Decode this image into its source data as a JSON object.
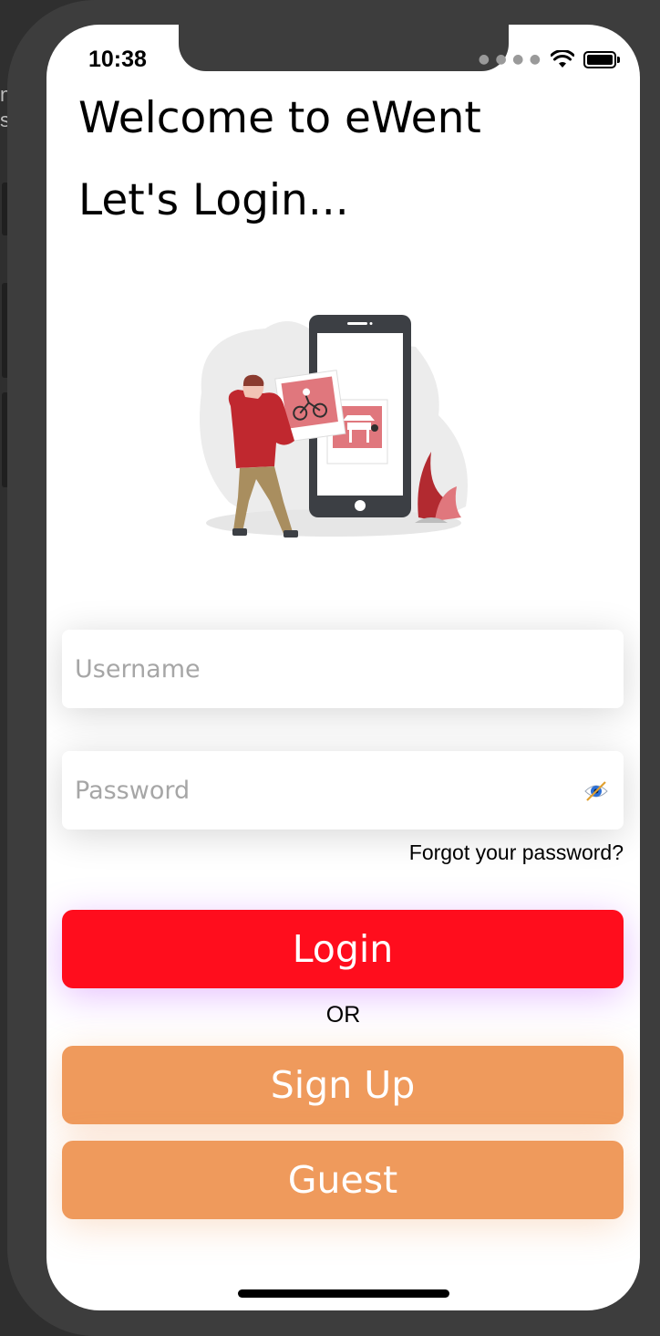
{
  "background_text": [
    "n",
    "s"
  ],
  "status_bar": {
    "time": "10:38",
    "icons": [
      "cellular-signal-icon",
      "wifi-icon",
      "battery-icon"
    ]
  },
  "header": {
    "title": "Welcome to eWent",
    "subtitle": "Let's Login..."
  },
  "illustration": {
    "name": "person-with-phone-photos-illustration"
  },
  "form": {
    "username": {
      "placeholder": "Username",
      "value": ""
    },
    "password": {
      "placeholder": "Password",
      "value": "",
      "toggle_icon": "eye-slash-icon"
    },
    "forgot_label": "Forgot your password?"
  },
  "actions": {
    "login_label": "Login",
    "or_label": "OR",
    "signup_label": "Sign Up",
    "guest_label": "Guest"
  },
  "colors": {
    "login": "#ff0d1d",
    "secondary": "#ef9a5c",
    "glow": "#c77dff"
  }
}
